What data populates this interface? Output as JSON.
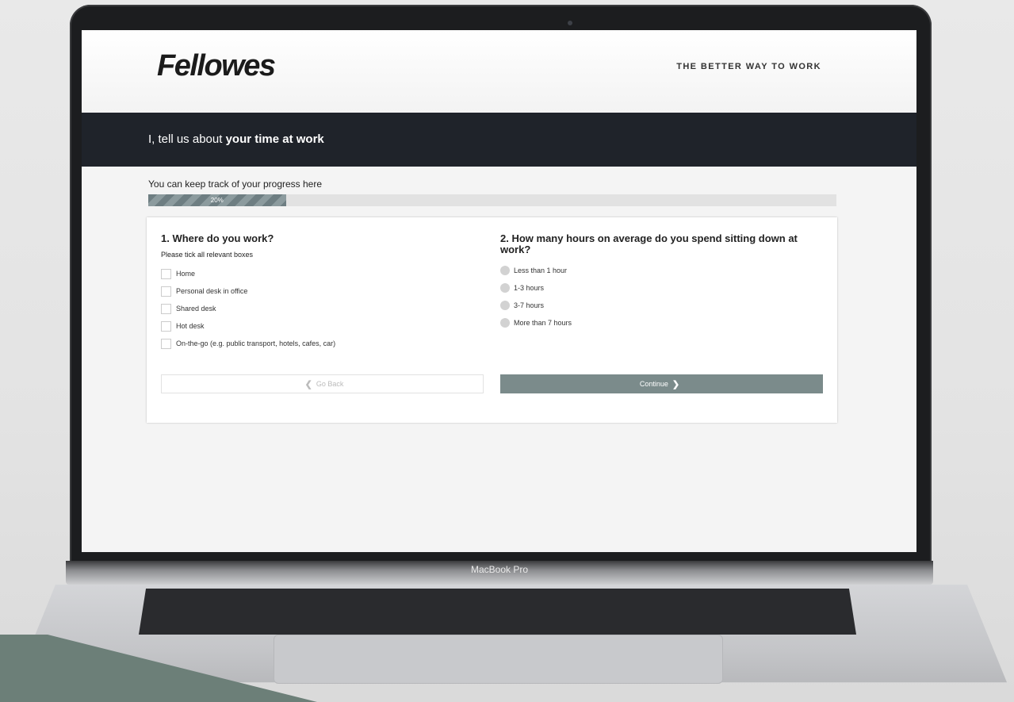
{
  "device": {
    "label": "MacBook Pro"
  },
  "header": {
    "logo": "Fellowes",
    "tagline": "THE BETTER WAY TO WORK"
  },
  "banner": {
    "prefix": "I, tell us about ",
    "emphasis": "your time at work"
  },
  "progress": {
    "label": "You can keep track of your progress here",
    "value_text": "20%",
    "value": 20
  },
  "question1": {
    "title": "1. Where do you work?",
    "hint": "Please tick all relevant boxes",
    "options": [
      "Home",
      "Personal desk in office",
      "Shared desk",
      "Hot desk",
      "On-the-go (e.g. public transport, hotels, cafes, car)"
    ]
  },
  "question2": {
    "title": "2. How many hours on average do you spend sitting down at work?",
    "options": [
      "Less than 1 hour",
      "1-3 hours",
      "3-7 hours",
      "More than 7 hours"
    ]
  },
  "buttons": {
    "back": "Go Back",
    "continue": "Continue"
  },
  "colors": {
    "banner": "#1f232a",
    "continue_button": "#7b8b8b",
    "progress_fill": "#7a898c",
    "accent_shape": "#6c7f78"
  }
}
